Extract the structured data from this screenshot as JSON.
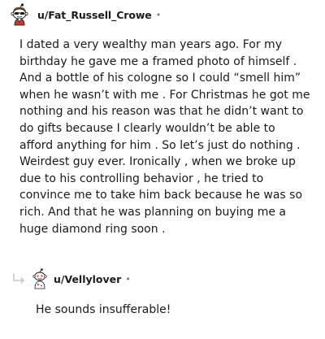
{
  "comment": {
    "username": "u/Fat_Russell_Crowe",
    "separator": "•",
    "avatar_icon": "snoo-avatar-icon",
    "body": "I dated a very wealthy man years ago. For my birthday he gave me a framed photo of himself . And a bottle of his cologne so I could “smell him” when he wasn’t with me . For Christmas he got me nothing and his reason was that he didn’t want to do gifts because I clearly wouldn’t be able to afford anything for him . So let’s just do nothing . Weirdest guy ever. Ironically , when we broke up due to his controlling behavior , he tried to convince me to take him back because he was so rich. And that he was planning on buying me a huge diamond ring soon ."
  },
  "reply": {
    "reply_icon": "reply-arrow-icon",
    "avatar_icon": "snoo-avatar-icon",
    "username": "u/Vellylover",
    "separator": "•",
    "body": "He sounds insufferable!"
  }
}
